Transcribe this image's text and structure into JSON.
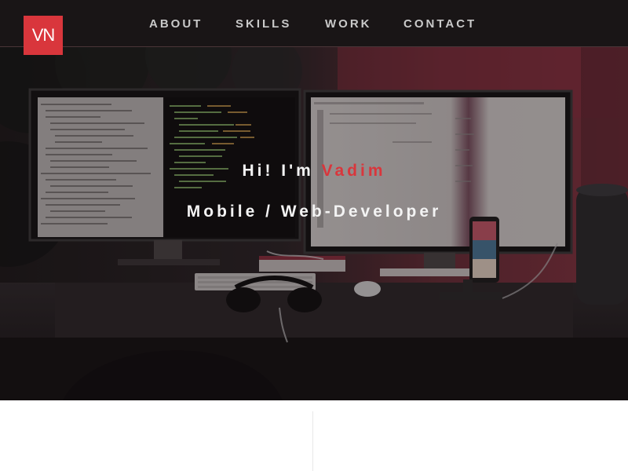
{
  "logo": {
    "text": "VN"
  },
  "nav": {
    "items": [
      {
        "label": "ABOUT"
      },
      {
        "label": "SKILLS"
      },
      {
        "label": "WORK"
      },
      {
        "label": "CONTACT"
      }
    ]
  },
  "hero": {
    "greeting_prefix": "Hi! I'm ",
    "greeting_name": "Vadim",
    "subtitle": "Mobile / Web-Developer"
  },
  "colors": {
    "accent": "#d9363c",
    "nav_background": "#191516",
    "nav_text": "#c9c9c9",
    "hero_text": "#f3f3f3"
  }
}
